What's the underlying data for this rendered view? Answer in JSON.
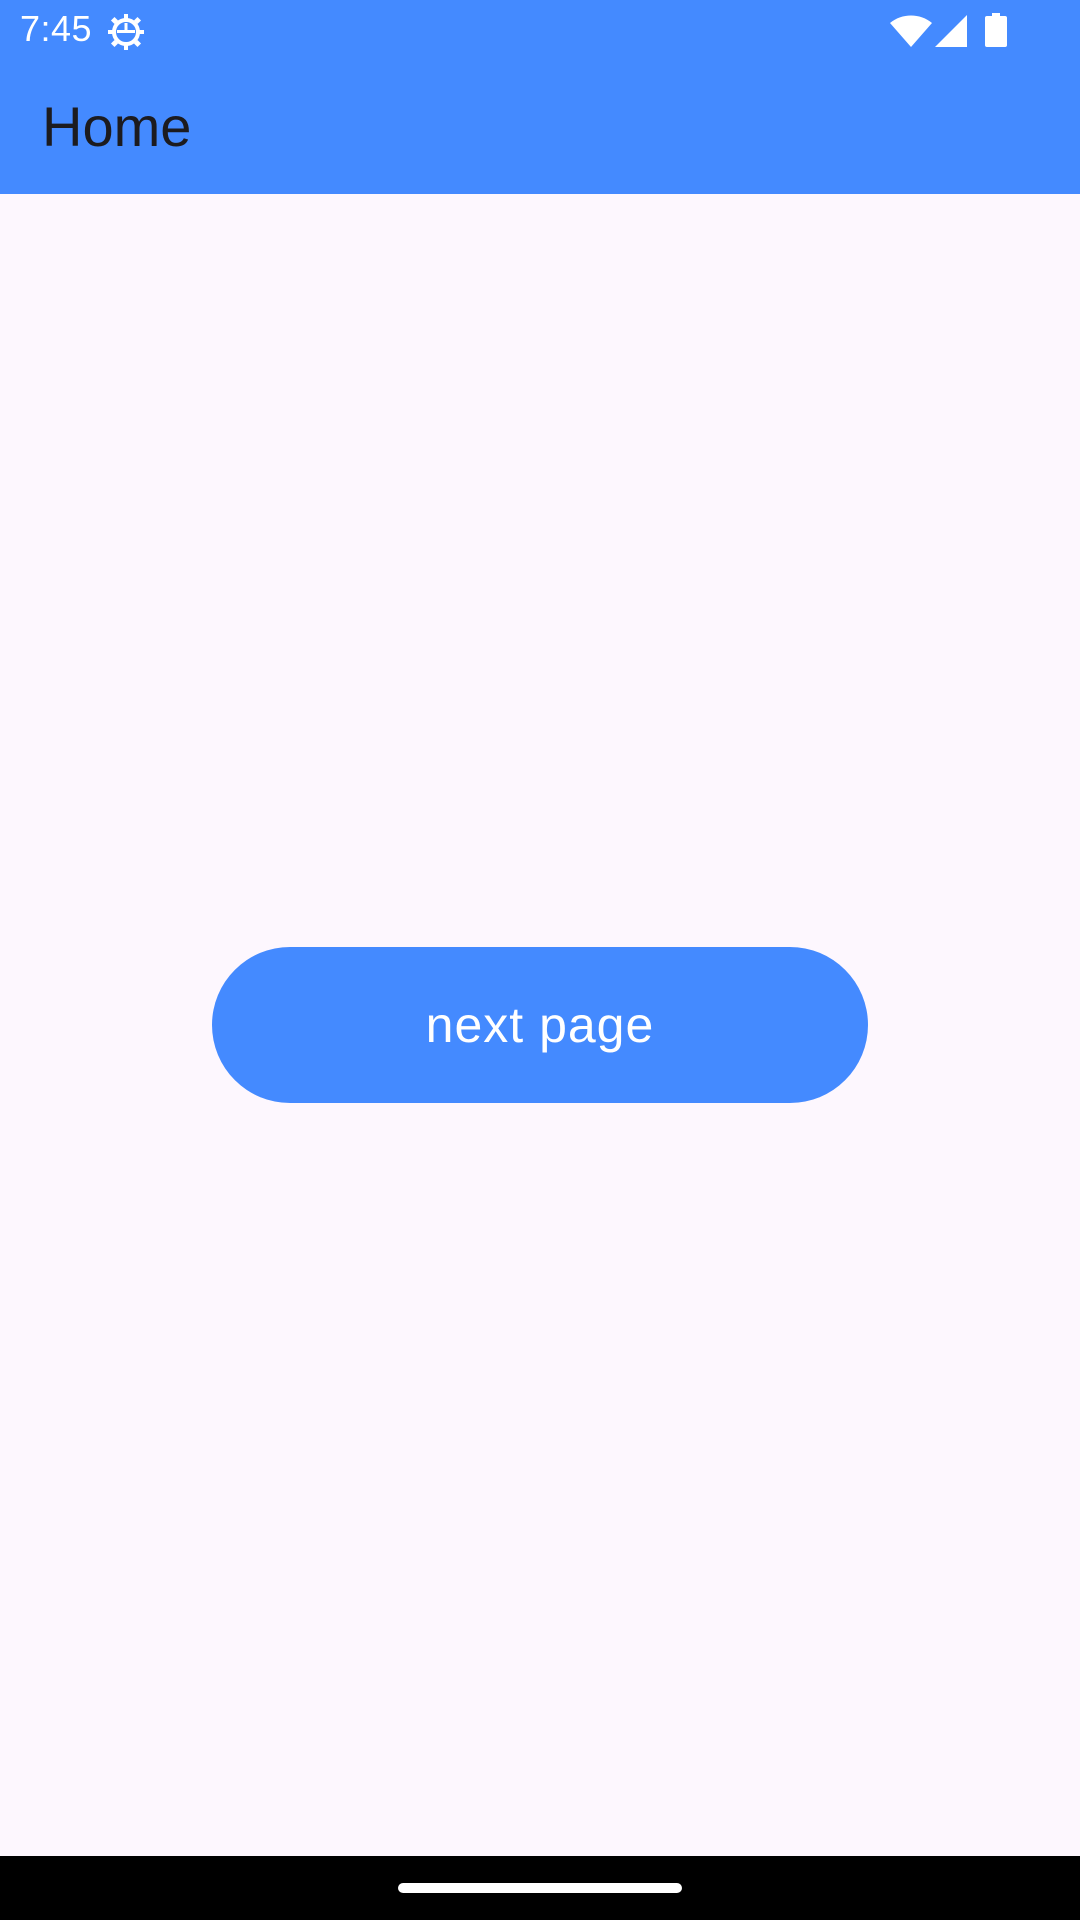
{
  "status_bar": {
    "time": "7:45",
    "icons": [
      "gear-icon",
      "wifi-icon",
      "signal-icon",
      "battery-icon"
    ]
  },
  "app_bar": {
    "title": "Home"
  },
  "main": {
    "next_button_label": "next page"
  },
  "colors": {
    "primary": "#448AFF",
    "background": "#FDF7FE",
    "title_text": "#1C1B1F",
    "button_text": "#FFFFFF",
    "navbar": "#000000"
  }
}
